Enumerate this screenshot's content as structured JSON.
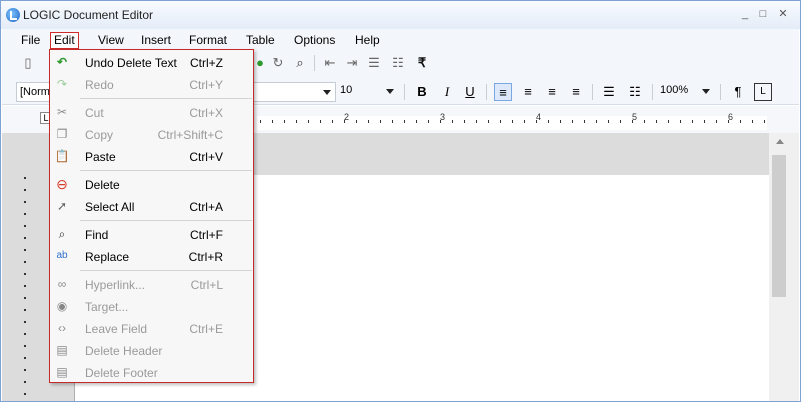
{
  "window": {
    "title": "LOGIC Document Editor",
    "minimize": "_",
    "maximize": "□",
    "close": "✕"
  },
  "menubar": {
    "items": [
      "File",
      "Edit",
      "View",
      "Insert",
      "Format",
      "Table",
      "Options",
      "Help"
    ]
  },
  "formatting": {
    "style_value": "[Norma",
    "font_size": "10",
    "zoom": "100%",
    "bold": "B",
    "italic": "I",
    "underline": "U",
    "paragraph_mark": "¶",
    "currency_symbol": "₹"
  },
  "ruler": {
    "marks": [
      "2",
      "3",
      "4",
      "5",
      "6"
    ],
    "tab_stop": "L"
  },
  "edit_menu": {
    "items": [
      {
        "label": "Undo Delete Text",
        "shortcut": "Ctrl+Z",
        "icon": "undo-icon",
        "enabled": true
      },
      {
        "label": "Redo",
        "shortcut": "Ctrl+Y",
        "icon": "redo-icon",
        "enabled": false
      },
      {
        "label": "Cut",
        "shortcut": "Ctrl+X",
        "icon": "scissors-icon",
        "enabled": false
      },
      {
        "label": "Copy",
        "shortcut": "Ctrl+Shift+C",
        "icon": "copy-icon",
        "enabled": false
      },
      {
        "label": "Paste",
        "shortcut": "Ctrl+V",
        "icon": "clipboard-icon",
        "enabled": true
      },
      {
        "label": "Delete",
        "shortcut": "",
        "icon": "delete-icon",
        "enabled": true
      },
      {
        "label": "Select All",
        "shortcut": "Ctrl+A",
        "icon": "cursor-icon",
        "enabled": true
      },
      {
        "label": "Find",
        "shortcut": "Ctrl+F",
        "icon": "binoculars-icon",
        "enabled": true
      },
      {
        "label": "Replace",
        "shortcut": "Ctrl+R",
        "icon": "replace-icon",
        "enabled": true
      },
      {
        "label": "Hyperlink...",
        "shortcut": "Ctrl+L",
        "icon": "link-icon",
        "enabled": false
      },
      {
        "label": "Target...",
        "shortcut": "",
        "icon": "target-icon",
        "enabled": false
      },
      {
        "label": "Leave Field",
        "shortcut": "Ctrl+E",
        "icon": "field-icon",
        "enabled": false
      },
      {
        "label": "Delete Header",
        "shortcut": "",
        "icon": "header-icon",
        "enabled": false
      },
      {
        "label": "Delete Footer",
        "shortcut": "",
        "icon": "footer-icon",
        "enabled": false
      }
    ]
  },
  "colors": {
    "accent_border": "#c42a2a",
    "selected_format": "#dde9fa"
  }
}
